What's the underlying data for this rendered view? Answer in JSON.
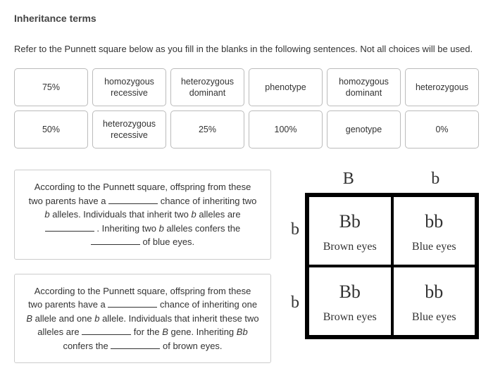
{
  "title": "Inheritance terms",
  "instructions": "Refer to the Punnett square below as you fill in the blanks in the following sentences. Not all choices will be used.",
  "choices": [
    "75%",
    "homozygous recessive",
    "heterozygous dominant",
    "phenotype",
    "homozygous dominant",
    "heterozygous",
    "50%",
    "heterozygous recessive",
    "25%",
    "100%",
    "genotype",
    "0%"
  ],
  "passage1": {
    "p1": "According to the Punnett square, offspring from these two parents have a ",
    "p2": " chance of inheriting two ",
    "ital1": "b",
    "p3": " alleles. Individuals that inherit two ",
    "ital2": "b",
    "p4": " alleles are ",
    "p5": " . Inheriting two ",
    "ital3": "b",
    "p6": " alleles confers the ",
    "p7": " of blue eyes."
  },
  "passage2": {
    "p1": "According to the Punnett square, offspring from these two parents have a ",
    "p2": " chance of inheriting one ",
    "ital1": "B",
    "p3": " allele and one ",
    "ital2": "b",
    "p4": " allele. Individuals that inherit these two alleles are ",
    "p5": " for the ",
    "ital3": "B",
    "p6": " gene. Inheriting ",
    "ital4": "Bb",
    "p7": " confers the ",
    "p8": " of brown eyes."
  },
  "punnett": {
    "top": [
      "B",
      "b"
    ],
    "side": [
      "b",
      "b"
    ],
    "cells": [
      {
        "geno": "Bb",
        "pheno": "Brown eyes"
      },
      {
        "geno": "bb",
        "pheno": "Blue eyes"
      },
      {
        "geno": "Bb",
        "pheno": "Brown eyes"
      },
      {
        "geno": "bb",
        "pheno": "Blue eyes"
      }
    ]
  },
  "chart_data": {
    "type": "table",
    "title": "Punnett square: Bb × bb",
    "col_headers": [
      "B",
      "b"
    ],
    "row_headers": [
      "b",
      "b"
    ],
    "cells": [
      [
        "Bb (Brown eyes)",
        "bb (Blue eyes)"
      ],
      [
        "Bb (Brown eyes)",
        "bb (Blue eyes)"
      ]
    ]
  }
}
